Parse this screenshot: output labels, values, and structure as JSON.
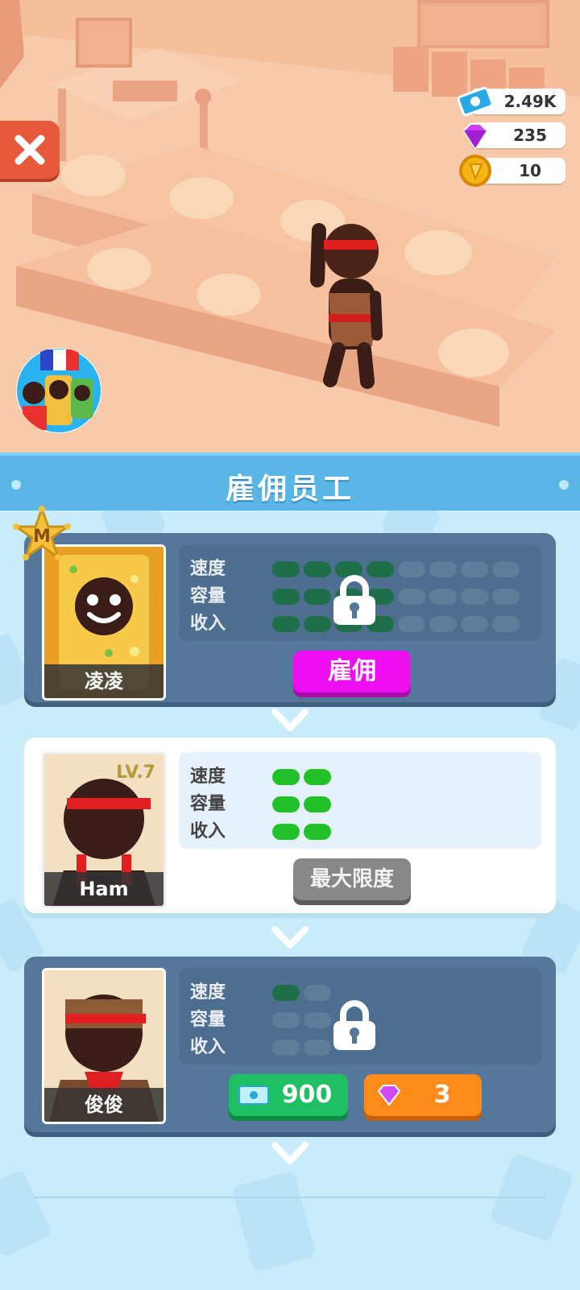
{
  "currencies": [
    {
      "name": "cash",
      "value": "2.49K",
      "icon": "cash-ticket-icon"
    },
    {
      "name": "gems",
      "value": "235",
      "icon": "gem-icon"
    },
    {
      "name": "coins",
      "value": "10",
      "icon": "coin-icon"
    }
  ],
  "panel": {
    "title": "雇佣员工"
  },
  "stat_labels": {
    "speed": "速度",
    "capacity": "容量",
    "income": "收入"
  },
  "workers": [
    {
      "name": "凌凌",
      "rank_badge": "M",
      "state": "locked",
      "stats": {
        "speed": 4,
        "capacity": 4,
        "income": 4
      },
      "max_pips": 8,
      "action": {
        "type": "hire",
        "label": "雇佣"
      }
    },
    {
      "name": "Ham",
      "level": "LV.7",
      "state": "hired",
      "stats": {
        "speed": 2,
        "capacity": 2,
        "income": 2
      },
      "max_pips": 2,
      "action": {
        "type": "max",
        "label": "最大限度"
      }
    },
    {
      "name": "俊俊",
      "state": "locked",
      "stats": {
        "speed": 1,
        "capacity": 0,
        "income": 0
      },
      "max_pips": 2,
      "prices": {
        "cash": "900",
        "gems": "3"
      }
    }
  ],
  "colors": {
    "pip_on_locked": "#1f6e4a",
    "pip_off_locked": "#5f7d99",
    "pip_on_active": "#22c12a",
    "hire": "#ee0ff0",
    "cash_button": "#1ec063",
    "gem_button": "#ff8b1a"
  }
}
